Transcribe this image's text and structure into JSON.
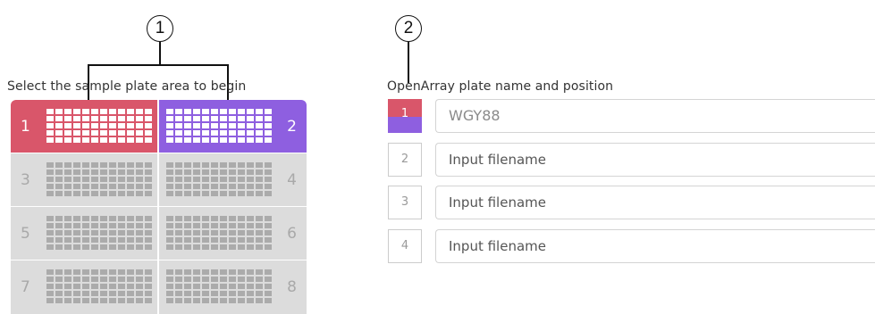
{
  "callouts": {
    "one": "1",
    "two": "2"
  },
  "left": {
    "heading": "Select the sample plate area to begin",
    "positions": [
      {
        "number": "1",
        "state": "selected-1"
      },
      {
        "number": "2",
        "state": "selected-2"
      },
      {
        "number": "3",
        "state": "empty"
      },
      {
        "number": "4",
        "state": "empty"
      },
      {
        "number": "5",
        "state": "empty"
      },
      {
        "number": "6",
        "state": "empty"
      },
      {
        "number": "7",
        "state": "empty"
      },
      {
        "number": "8",
        "state": "empty"
      }
    ]
  },
  "right": {
    "heading": "OpenArray plate name and position",
    "rows": [
      {
        "position": "1",
        "value": "WGY88",
        "placeholder": "Input filename"
      },
      {
        "position": "2",
        "value": "",
        "placeholder": "Input filename"
      },
      {
        "position": "3",
        "value": "",
        "placeholder": "Input filename"
      },
      {
        "position": "4",
        "value": "",
        "placeholder": "Input filename"
      }
    ]
  },
  "colors": {
    "position_1": "#d9566a",
    "position_2": "#8e5fe0",
    "empty": "#dcdcdc"
  }
}
